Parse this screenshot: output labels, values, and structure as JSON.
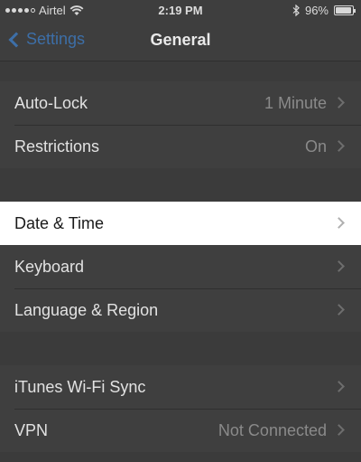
{
  "status_bar": {
    "carrier": "Airtel",
    "time": "2:19 PM",
    "battery": "96%",
    "battery_level": 0.96,
    "icons": [
      "signal-dots-icon",
      "wifi-icon",
      "bluetooth-icon",
      "battery-icon"
    ]
  },
  "nav": {
    "back_label": "Settings",
    "title": "General"
  },
  "groups": [
    [
      {
        "label": "Auto-Lock",
        "value": "1 Minute"
      },
      {
        "label": "Restrictions",
        "value": "On"
      }
    ],
    [
      {
        "label": "Date & Time",
        "value": "",
        "highlighted": true
      },
      {
        "label": "Keyboard",
        "value": ""
      },
      {
        "label": "Language & Region",
        "value": ""
      }
    ],
    [
      {
        "label": "iTunes Wi-Fi Sync",
        "value": ""
      },
      {
        "label": "VPN",
        "value": "Not Connected"
      }
    ]
  ],
  "colors": {
    "accent": "#3d6fa8",
    "background": "#3b3b3b",
    "highlight": "#ffffff"
  }
}
